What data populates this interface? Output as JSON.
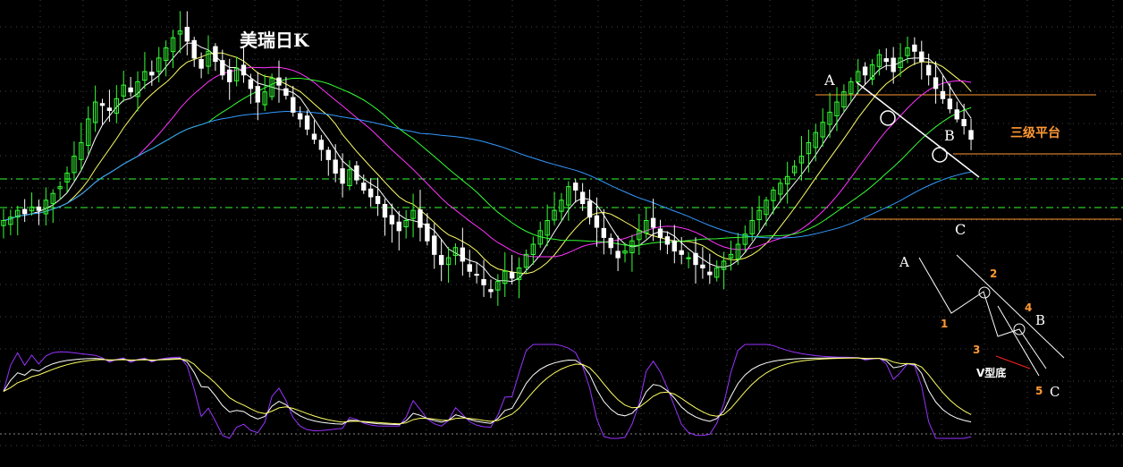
{
  "title": "美瑞日K",
  "annotations": {
    "point_a": "A",
    "point_b": "B",
    "point_c": "C",
    "zone": "三级平台",
    "schematic_a": "A",
    "schematic_b": "B",
    "schematic_c": "C",
    "schematic_v": "V型底",
    "num_1": "1",
    "num_2": "2",
    "num_3": "3",
    "num_4": "4",
    "num_5": "5"
  },
  "colors": {
    "background": "#000000",
    "candle_up": "#33ff33",
    "candle_down": "#ffffff",
    "ma5": "#ffffff",
    "ma10": "#ffff66",
    "ma20": "#ff33ff",
    "ma30": "#33ff33",
    "ma60": "#3399ff",
    "k_line": "#ffffff",
    "d_line": "#ffff66",
    "j_line": "#9933ff",
    "trendline": "#ffffff",
    "level_line": "#ff9933",
    "grid": "#444444",
    "dash_level": "#33ff33"
  },
  "chart_data": {
    "type": "candlestick",
    "title": "美瑞日K",
    "xlabel": "",
    "ylabel": "",
    "grid": true,
    "indicator_panel": "KDJ-style oscillator below price chart",
    "closes": [
      150,
      152,
      156,
      154,
      158,
      156,
      162,
      166,
      170,
      178,
      188,
      196,
      210,
      220,
      218,
      215,
      222,
      230,
      226,
      232,
      238,
      236,
      246,
      252,
      258,
      262,
      256,
      246,
      240,
      250,
      244,
      236,
      232,
      240,
      236,
      228,
      220,
      226,
      234,
      230,
      224,
      214,
      210,
      204,
      198,
      192,
      186,
      178,
      172,
      180,
      174,
      168,
      164,
      160,
      152,
      148,
      144,
      150,
      156,
      146,
      138,
      130,
      124,
      128,
      134,
      126,
      120,
      118,
      112,
      108,
      114,
      120,
      116,
      122,
      130,
      136,
      144,
      150,
      156,
      162,
      170,
      168,
      160,
      152,
      146,
      140,
      134,
      128,
      132,
      138,
      144,
      150,
      146,
      140,
      136,
      132,
      130,
      128,
      124,
      122,
      118,
      122,
      126,
      130,
      136,
      142,
      150,
      156,
      162,
      168,
      172,
      176,
      182,
      188,
      196,
      202,
      208,
      214,
      220,
      226,
      232,
      238,
      236,
      242,
      248,
      244,
      238,
      246,
      252,
      250,
      244,
      236,
      228,
      222,
      216,
      210,
      206,
      198
    ],
    "levels": {
      "point_a_high": 258,
      "point_b_level": 236,
      "point_c_low": 198
    }
  }
}
